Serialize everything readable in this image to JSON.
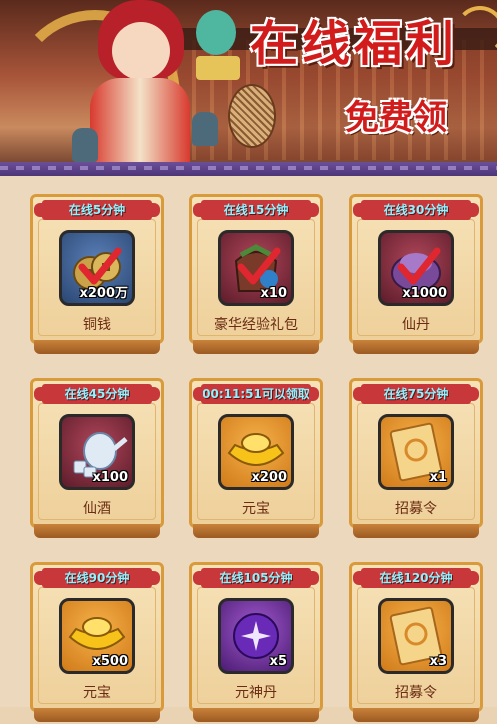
{
  "banner": {
    "title": "在线福利",
    "subtitle": "免费领"
  },
  "rewards": [
    {
      "time_label": "在线5分钟",
      "name": "铜钱",
      "qty": "x200万",
      "icon": "copper-coins-icon",
      "slot": "blue",
      "claimed": true
    },
    {
      "time_label": "在线15分钟",
      "name": "豪华经验礼包",
      "qty": "x10",
      "icon": "exp-gift-bag-icon",
      "slot": "red",
      "claimed": true
    },
    {
      "time_label": "在线30分钟",
      "name": "仙丹",
      "qty": "x1000",
      "icon": "elixir-pill-icon",
      "slot": "red",
      "claimed": true
    },
    {
      "time_label": "在线45分钟",
      "name": "仙酒",
      "qty": "x100",
      "icon": "wine-teapot-icon",
      "slot": "red",
      "claimed": false
    },
    {
      "time_label": "00:11:51可以领取",
      "name": "元宝",
      "qty": "x200",
      "icon": "gold-ingot-icon",
      "slot": "orange",
      "claimed": false
    },
    {
      "time_label": "在线75分钟",
      "name": "招募令",
      "qty": "x1",
      "icon": "recruit-token-icon",
      "slot": "orange",
      "claimed": false
    },
    {
      "time_label": "在线90分钟",
      "name": "元宝",
      "qty": "x500",
      "icon": "gold-ingot-icon",
      "slot": "orange",
      "claimed": false
    },
    {
      "time_label": "在线105分钟",
      "name": "元神丹",
      "qty": "x5",
      "icon": "spirit-orb-icon",
      "slot": "purple",
      "claimed": false
    },
    {
      "time_label": "在线120分钟",
      "name": "招募令",
      "qty": "x3",
      "icon": "recruit-token-icon",
      "slot": "orange",
      "claimed": false
    }
  ],
  "colors": {
    "ribbon": "#c8383a",
    "ribbon_text": "#8ff2ff",
    "name_text": "#6a2c12",
    "frame_border": "#d99a3c",
    "check": "#e0262e"
  }
}
